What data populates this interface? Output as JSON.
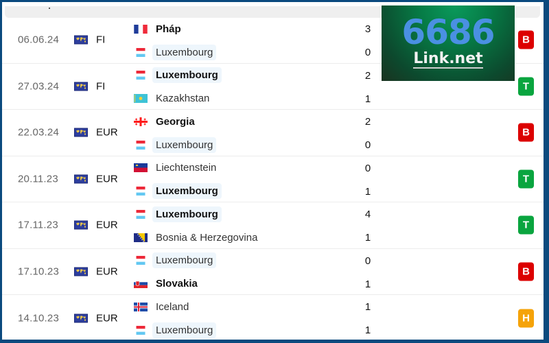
{
  "colors": {
    "frame": "#0b4a7e",
    "win": "#0aa53f",
    "loss": "#dc0000",
    "draw": "#f5a30a",
    "highlight": "#eef6fc"
  },
  "ad": {
    "big_text": "6686",
    "small_text": "Link.net"
  },
  "matches": [
    {
      "date": "06.06.24",
      "competition": "FI",
      "competition_icon": "world-map-icon",
      "home": {
        "name": "Pháp",
        "flag": "france",
        "bold": true,
        "highlight": false,
        "score": "3"
      },
      "away": {
        "name": "Luxembourg",
        "flag": "luxembourg",
        "bold": false,
        "highlight": true,
        "score": "0"
      },
      "result": "B",
      "result_type": "loss"
    },
    {
      "date": "27.03.24",
      "competition": "FI",
      "competition_icon": "world-map-icon",
      "home": {
        "name": "Luxembourg",
        "flag": "luxembourg",
        "bold": true,
        "highlight": true,
        "score": "2"
      },
      "away": {
        "name": "Kazakhstan",
        "flag": "kazakhstan",
        "bold": false,
        "highlight": false,
        "score": "1"
      },
      "result": "T",
      "result_type": "win"
    },
    {
      "date": "22.03.24",
      "competition": "EUR",
      "competition_icon": "world-map-icon",
      "home": {
        "name": "Georgia",
        "flag": "georgia",
        "bold": true,
        "highlight": false,
        "score": "2"
      },
      "away": {
        "name": "Luxembourg",
        "flag": "luxembourg",
        "bold": false,
        "highlight": true,
        "score": "0"
      },
      "result": "B",
      "result_type": "loss"
    },
    {
      "date": "20.11.23",
      "competition": "EUR",
      "competition_icon": "world-map-icon",
      "home": {
        "name": "Liechtenstein",
        "flag": "liechtenstein",
        "bold": false,
        "highlight": false,
        "score": "0"
      },
      "away": {
        "name": "Luxembourg",
        "flag": "luxembourg",
        "bold": true,
        "highlight": true,
        "score": "1"
      },
      "result": "T",
      "result_type": "win"
    },
    {
      "date": "17.11.23",
      "competition": "EUR",
      "competition_icon": "world-map-icon",
      "home": {
        "name": "Luxembourg",
        "flag": "luxembourg",
        "bold": true,
        "highlight": true,
        "score": "4"
      },
      "away": {
        "name": "Bosnia & Herzegovina",
        "flag": "bosnia",
        "bold": false,
        "highlight": false,
        "score": "1"
      },
      "result": "T",
      "result_type": "win"
    },
    {
      "date": "17.10.23",
      "competition": "EUR",
      "competition_icon": "world-map-icon",
      "home": {
        "name": "Luxembourg",
        "flag": "luxembourg",
        "bold": false,
        "highlight": true,
        "score": "0"
      },
      "away": {
        "name": "Slovakia",
        "flag": "slovakia",
        "bold": true,
        "highlight": false,
        "score": "1"
      },
      "result": "B",
      "result_type": "loss"
    },
    {
      "date": "14.10.23",
      "competition": "EUR",
      "competition_icon": "world-map-icon",
      "home": {
        "name": "Iceland",
        "flag": "iceland",
        "bold": false,
        "highlight": false,
        "score": "1"
      },
      "away": {
        "name": "Luxembourg",
        "flag": "luxembourg",
        "bold": false,
        "highlight": true,
        "score": "1"
      },
      "result": "H",
      "result_type": "draw"
    }
  ]
}
